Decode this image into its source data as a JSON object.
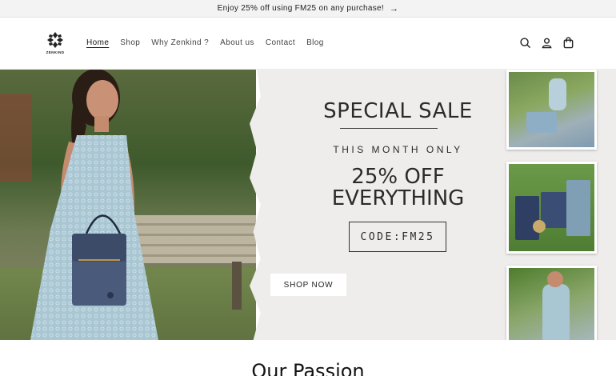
{
  "announcement": {
    "text": "Enjoy 25% off using FM25 on any purchase!",
    "arrow_icon": "arrow-right-icon"
  },
  "header": {
    "logo_text": "ZENKIND",
    "nav": [
      {
        "label": "Home",
        "active": true
      },
      {
        "label": "Shop"
      },
      {
        "label": "Why Zenkind ?"
      },
      {
        "label": "About us"
      },
      {
        "label": "Contact"
      },
      {
        "label": "Blog"
      }
    ],
    "icons": [
      "search-icon",
      "account-icon",
      "cart-icon"
    ]
  },
  "hero": {
    "title": "SPECIAL SALE",
    "subtitle": "THIS MONTH ONLY",
    "offer_line1": "25% OFF",
    "offer_line2": "EVERYTHING",
    "code": "CODE:FM25",
    "button_label": "SHOP NOW"
  },
  "section": {
    "heading": "Our Passion"
  }
}
